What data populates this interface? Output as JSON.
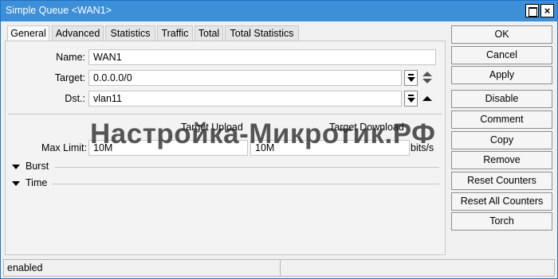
{
  "window": {
    "title": "Simple Queue <WAN1>"
  },
  "tabs": [
    {
      "label": "General"
    },
    {
      "label": "Advanced"
    },
    {
      "label": "Statistics"
    },
    {
      "label": "Traffic"
    },
    {
      "label": "Total"
    },
    {
      "label": "Total Statistics"
    }
  ],
  "active_tab": "General",
  "form": {
    "name_label": "Name:",
    "name_value": "WAN1",
    "target_label": "Target:",
    "target_value": "0.0.0.0/0",
    "dst_label": "Dst.:",
    "dst_value": "vlan11",
    "target_upload_label": "Target Upload",
    "target_download_label": "Target Download",
    "max_limit_label": "Max Limit:",
    "max_limit_upload": "10M",
    "max_limit_download": "10M",
    "units": "bits/s",
    "burst_label": "Burst",
    "time_label": "Time"
  },
  "watermark": "Настройка-Микротик.РФ",
  "buttons": {
    "ok": "OK",
    "cancel": "Cancel",
    "apply": "Apply",
    "disable": "Disable",
    "comment": "Comment",
    "copy": "Copy",
    "remove": "Remove",
    "reset_counters": "Reset Counters",
    "reset_all_counters": "Reset All Counters",
    "torch": "Torch"
  },
  "status": {
    "left": "enabled",
    "right": ""
  },
  "colors": {
    "titlebar": "#3d8fd8",
    "window_bg": "#f0f0f0"
  }
}
